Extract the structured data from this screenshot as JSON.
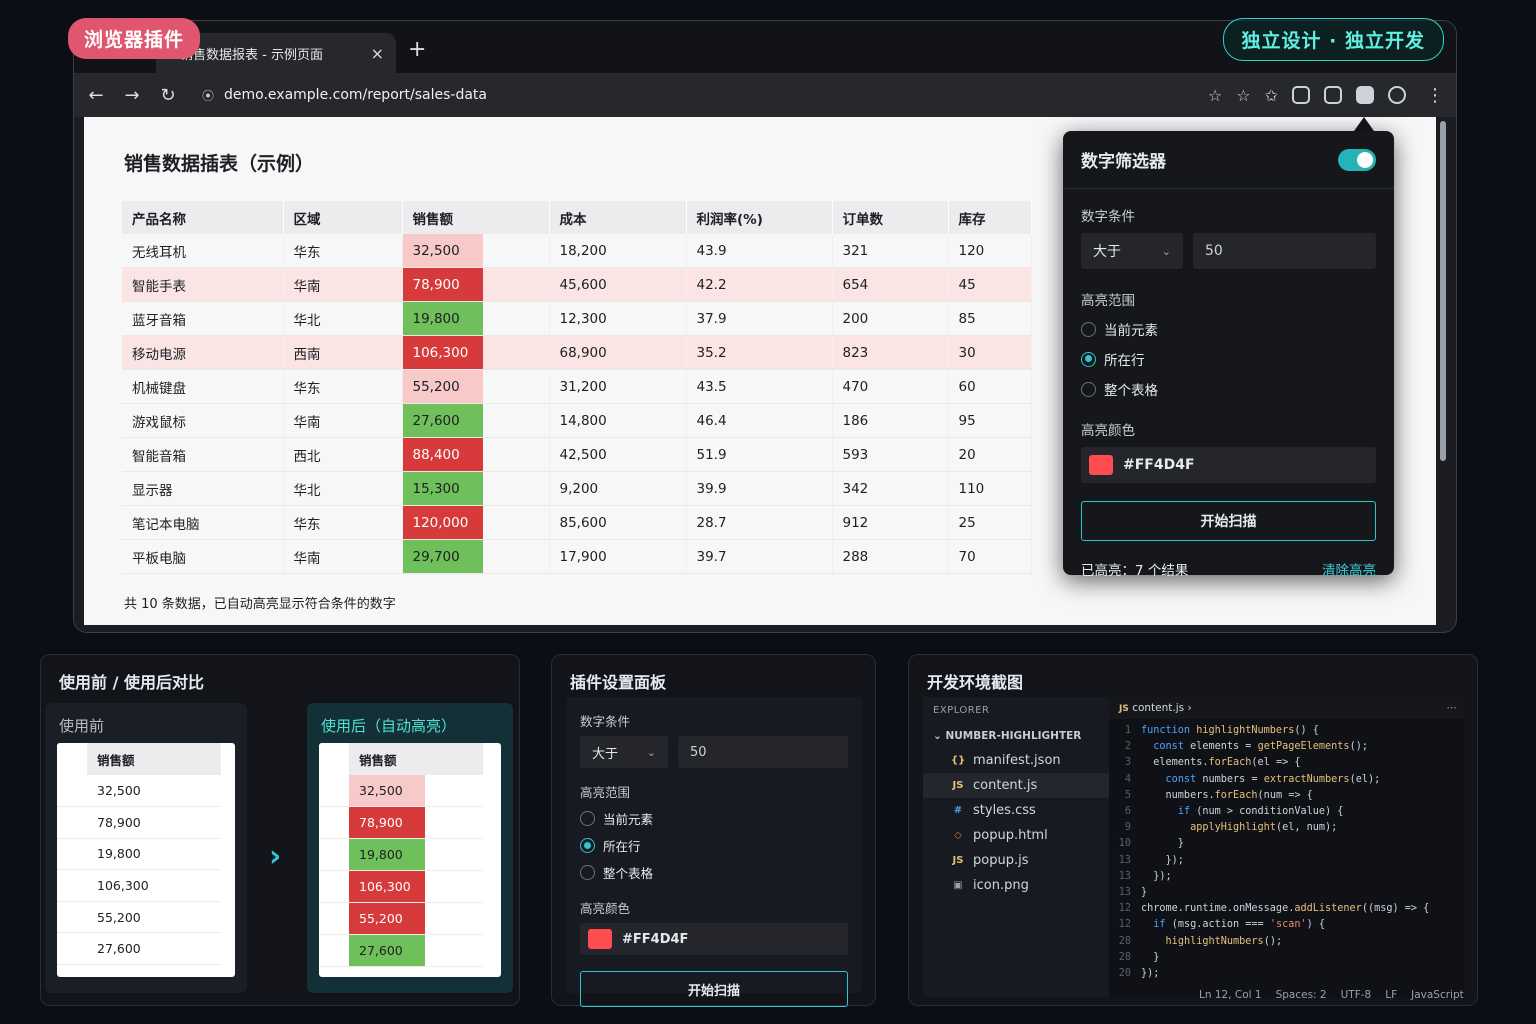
{
  "badges": {
    "left": "浏览器插件",
    "right": "独立设计 · 独立开发"
  },
  "browser": {
    "tab_title": "销售数据报表 - 示例页面",
    "tab_close": "×",
    "new_tab": "+",
    "url": "demo.example.com/report/sales-data"
  },
  "page": {
    "title": "销售数据插表（示例）",
    "headers": [
      "产品名称",
      "区域",
      "销售额",
      "成本",
      "利润率(%)",
      "订单数",
      "库存"
    ],
    "rows": [
      [
        "无线耳机",
        "华东",
        "32,500",
        "18,200",
        "43.9",
        "321",
        "120"
      ],
      [
        "智能手表",
        "华南",
        "78,900",
        "45,600",
        "42.2",
        "654",
        "45"
      ],
      [
        "蓝牙音箱",
        "华北",
        "19,800",
        "12,300",
        "37.9",
        "200",
        "85"
      ],
      [
        "移动电源",
        "西南",
        "106,300",
        "68,900",
        "35.2",
        "823",
        "30"
      ],
      [
        "机械键盘",
        "华东",
        "55,200",
        "31,200",
        "43.5",
        "470",
        "60"
      ],
      [
        "游戏鼠标",
        "华南",
        "27,600",
        "14,800",
        "46.4",
        "186",
        "95"
      ],
      [
        "智能音箱",
        "西北",
        "88,400",
        "42,500",
        "51.9",
        "593",
        "20"
      ],
      [
        "显示器",
        "华北",
        "15,300",
        "9,200",
        "39.9",
        "342",
        "110"
      ],
      [
        "笔记本电脑",
        "华东",
        "120,000",
        "85,600",
        "28.7",
        "912",
        "25"
      ],
      [
        "平板电脑",
        "华南",
        "29,700",
        "17,900",
        "39.7",
        "288",
        "70"
      ]
    ],
    "footer": "共 10 条数据，已自动高亮显示符合条件的数字"
  },
  "popup": {
    "title": "数字筛选器",
    "cond_label": "数字条件",
    "cond_select": "大于",
    "cond_value": "50",
    "range_label": "高亮范围",
    "range_options": [
      "当前元素",
      "所在行",
      "整个表格"
    ],
    "color_label": "高亮颜色",
    "color_value": "#FF4D4F",
    "scan_button": "开始扫描",
    "result": "已高亮：7 个结果",
    "clear": "清除高亮"
  },
  "compare": {
    "title": "使用前 / 使用后对比",
    "before_label": "使用前",
    "after_label": "使用后（自动高亮）",
    "col": "销售额",
    "values": [
      "32,500",
      "78,900",
      "19,800",
      "106,300",
      "55,200",
      "27,600"
    ]
  },
  "settings": {
    "title": "插件设置面板",
    "cond_label": "数字条件",
    "cond_select": "大于",
    "cond_value": "50",
    "range_label": "高亮范围",
    "range_options": [
      "当前元素",
      "所在行",
      "整个表格"
    ],
    "color_label": "高亮颜色",
    "color_value": "#FF4D4F",
    "scan_button": "开始扫描"
  },
  "devenv": {
    "title": "开发环境截图",
    "explorer": "EXPLORER",
    "project": "NUMBER-HIGHLIGHTER",
    "files": [
      "manifest.json",
      "content.js",
      "styles.css",
      "popup.html",
      "popup.js",
      "icon.png"
    ],
    "editor_tab": "content.js",
    "status": [
      "Ln 12, Col 1",
      "Spaces: 2",
      "UTF-8",
      "LF",
      "JavaScript"
    ]
  },
  "colors": {
    "accent": "#2fc4d0",
    "highlight_red": "#d63a3a",
    "highlight_green": "#6fc05a",
    "swatch": "#FF4D4F"
  }
}
